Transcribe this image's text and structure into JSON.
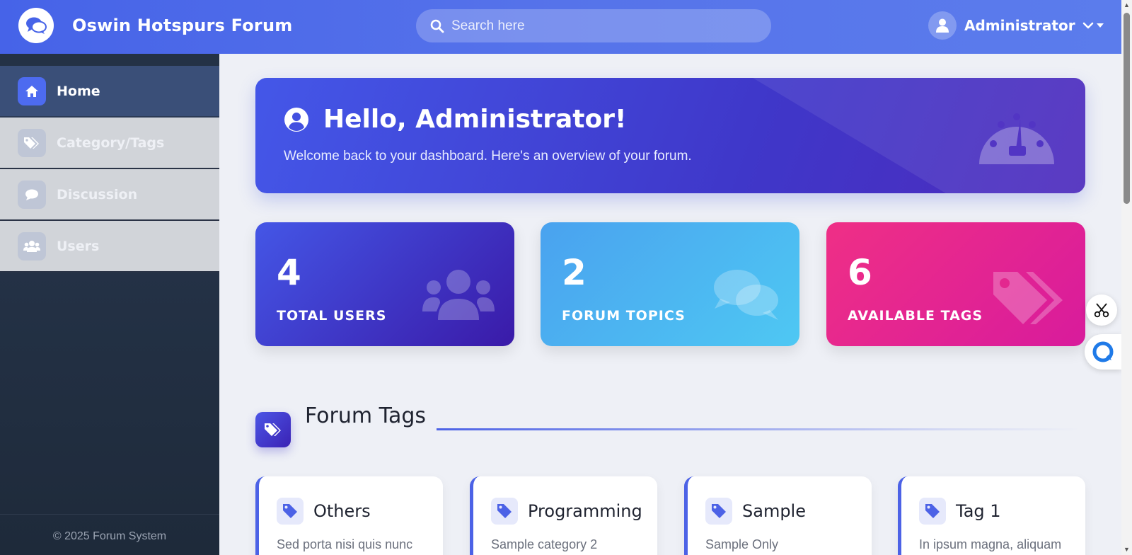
{
  "header": {
    "brand": "Oswin Hotspurs Forum",
    "search_placeholder": "Search here",
    "user_name": "Administrator"
  },
  "sidebar": {
    "items": [
      {
        "label": "Home",
        "icon": "home-icon",
        "active": true
      },
      {
        "label": "Category/Tags",
        "icon": "tags-icon",
        "active": false
      },
      {
        "label": "Discussion",
        "icon": "comment-icon",
        "active": false
      },
      {
        "label": "Users",
        "icon": "users-icon",
        "active": false
      }
    ],
    "footer": "© 2025 Forum System"
  },
  "hero": {
    "title": "Hello, Administrator!",
    "subtitle": "Welcome back to your dashboard. Here's an overview of your forum."
  },
  "stats": [
    {
      "value": "4",
      "label": "TOTAL USERS",
      "icon": "users-icon"
    },
    {
      "value": "2",
      "label": "FORUM TOPICS",
      "icon": "comments-icon"
    },
    {
      "value": "6",
      "label": "AVAILABLE TAGS",
      "icon": "tags-icon"
    }
  ],
  "section": {
    "title": "Forum Tags"
  },
  "tags": [
    {
      "name": "Others",
      "desc": "Sed porta nisi quis nunc"
    },
    {
      "name": "Programming",
      "desc": "Sample category 2"
    },
    {
      "name": "Sample",
      "desc": "Sample Only"
    },
    {
      "name": "Tag 1",
      "desc": "In ipsum magna, aliquam"
    }
  ],
  "colors": {
    "primary": "#4c62e6",
    "topic_card": "#4ec8f3",
    "tag_card": "#ef2f86",
    "sidebar": "#1e2a3a"
  }
}
